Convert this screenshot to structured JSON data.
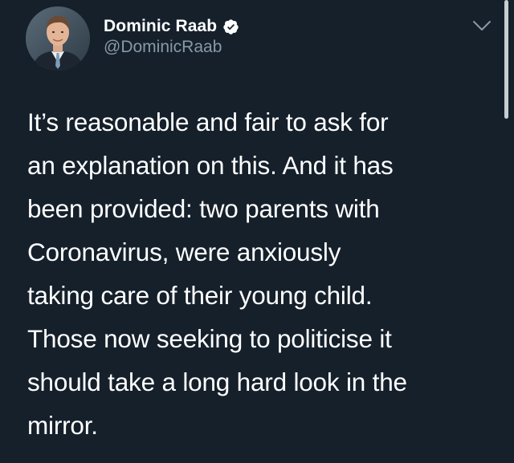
{
  "author": {
    "display_name": "Dominic Raab",
    "handle": "@DominicRaab",
    "verified": true
  },
  "tweet": {
    "text": "It’s reasonable and fair to ask for\nan explanation on this. And it has\nbeen provided: two parents with\nCoronavirus, were anxiously\ntaking care of their young child.\nThose now seeking to politicise it\nshould take a long hard look in the\nmirror."
  },
  "icons": {
    "verified": "verified-badge-icon",
    "menu": "chevron-down-icon"
  },
  "colors": {
    "background": "#15202b",
    "primary_text": "#ffffff",
    "secondary_text": "#8899a6"
  }
}
